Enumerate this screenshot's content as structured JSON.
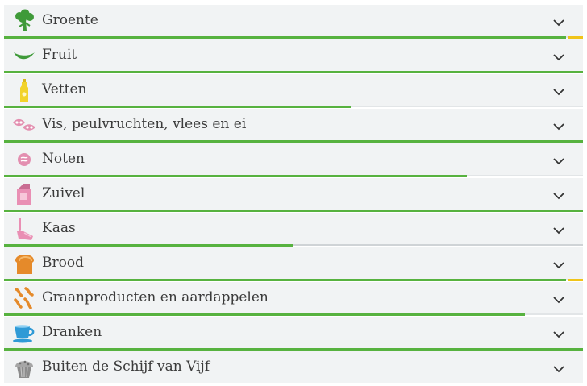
{
  "categories": [
    {
      "label": "Groente",
      "icon": "broccoli-icon",
      "progress": 0.973,
      "over": true,
      "color": "#3f9a39"
    },
    {
      "label": "Fruit",
      "icon": "bean-pod-icon",
      "progress": 1.0,
      "over": false,
      "color": "#3f9a39"
    },
    {
      "label": "Vetten",
      "icon": "oil-bottle-icon",
      "progress": 0.598,
      "over": false,
      "color": "#f2d32b"
    },
    {
      "label": "Vis, peulvruchten, vlees en ei",
      "icon": "fish-beans-icon",
      "progress": 1.0,
      "over": false,
      "color": "#e38fb0"
    },
    {
      "label": "Noten",
      "icon": "nut-icon",
      "progress": 0.799,
      "over": false,
      "color": "#e38fb0"
    },
    {
      "label": "Zuivel",
      "icon": "milk-carton-icon",
      "progress": 1.0,
      "over": false,
      "color": "#e98fb4"
    },
    {
      "label": "Kaas",
      "icon": "cheese-slicer-icon",
      "progress": 0.5,
      "over": false,
      "color": "#e98fb4"
    },
    {
      "label": "Brood",
      "icon": "bread-icon",
      "progress": 0.973,
      "over": true,
      "color": "#e58a2a"
    },
    {
      "label": "Graanproducten en aardappelen",
      "icon": "pasta-icon",
      "progress": 0.9,
      "over": false,
      "color": "#e58a2a"
    },
    {
      "label": "Dranken",
      "icon": "cup-icon",
      "progress": 1.0,
      "over": false,
      "color": "#2f9ad6"
    },
    {
      "label": "Buiten de Schijf van Vijf",
      "icon": "muffin-icon",
      "progress": 1.0,
      "over": false,
      "color": "#a6a6a6"
    }
  ],
  "colors": {
    "progress_fill": "#57b23f",
    "progress_over": "#f0c419",
    "progress_track": "#e2e5e7",
    "row_background": "#f1f3f4"
  }
}
